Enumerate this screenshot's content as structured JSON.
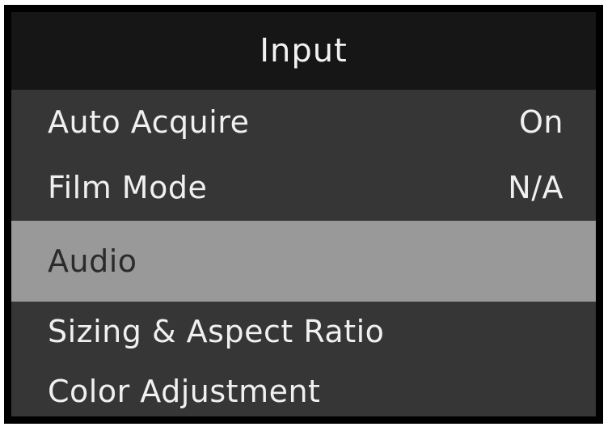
{
  "menu": {
    "title": "Input",
    "items": [
      {
        "label": "Auto Acquire",
        "value": "On",
        "selected": false
      },
      {
        "label": "Film Mode",
        "value": "N/A",
        "selected": false
      },
      {
        "label": "Audio",
        "value": "",
        "selected": true
      },
      {
        "label": "Sizing & Aspect Ratio",
        "value": "",
        "selected": false
      },
      {
        "label": "Color Adjustment",
        "value": "",
        "selected": false
      }
    ]
  },
  "colors": {
    "frame": "#000000",
    "header_bg": "#161616",
    "menu_bg": "#363636",
    "selected_bg": "#999999",
    "text": "#f0f0f0",
    "selected_text": "#2b2b2b"
  }
}
